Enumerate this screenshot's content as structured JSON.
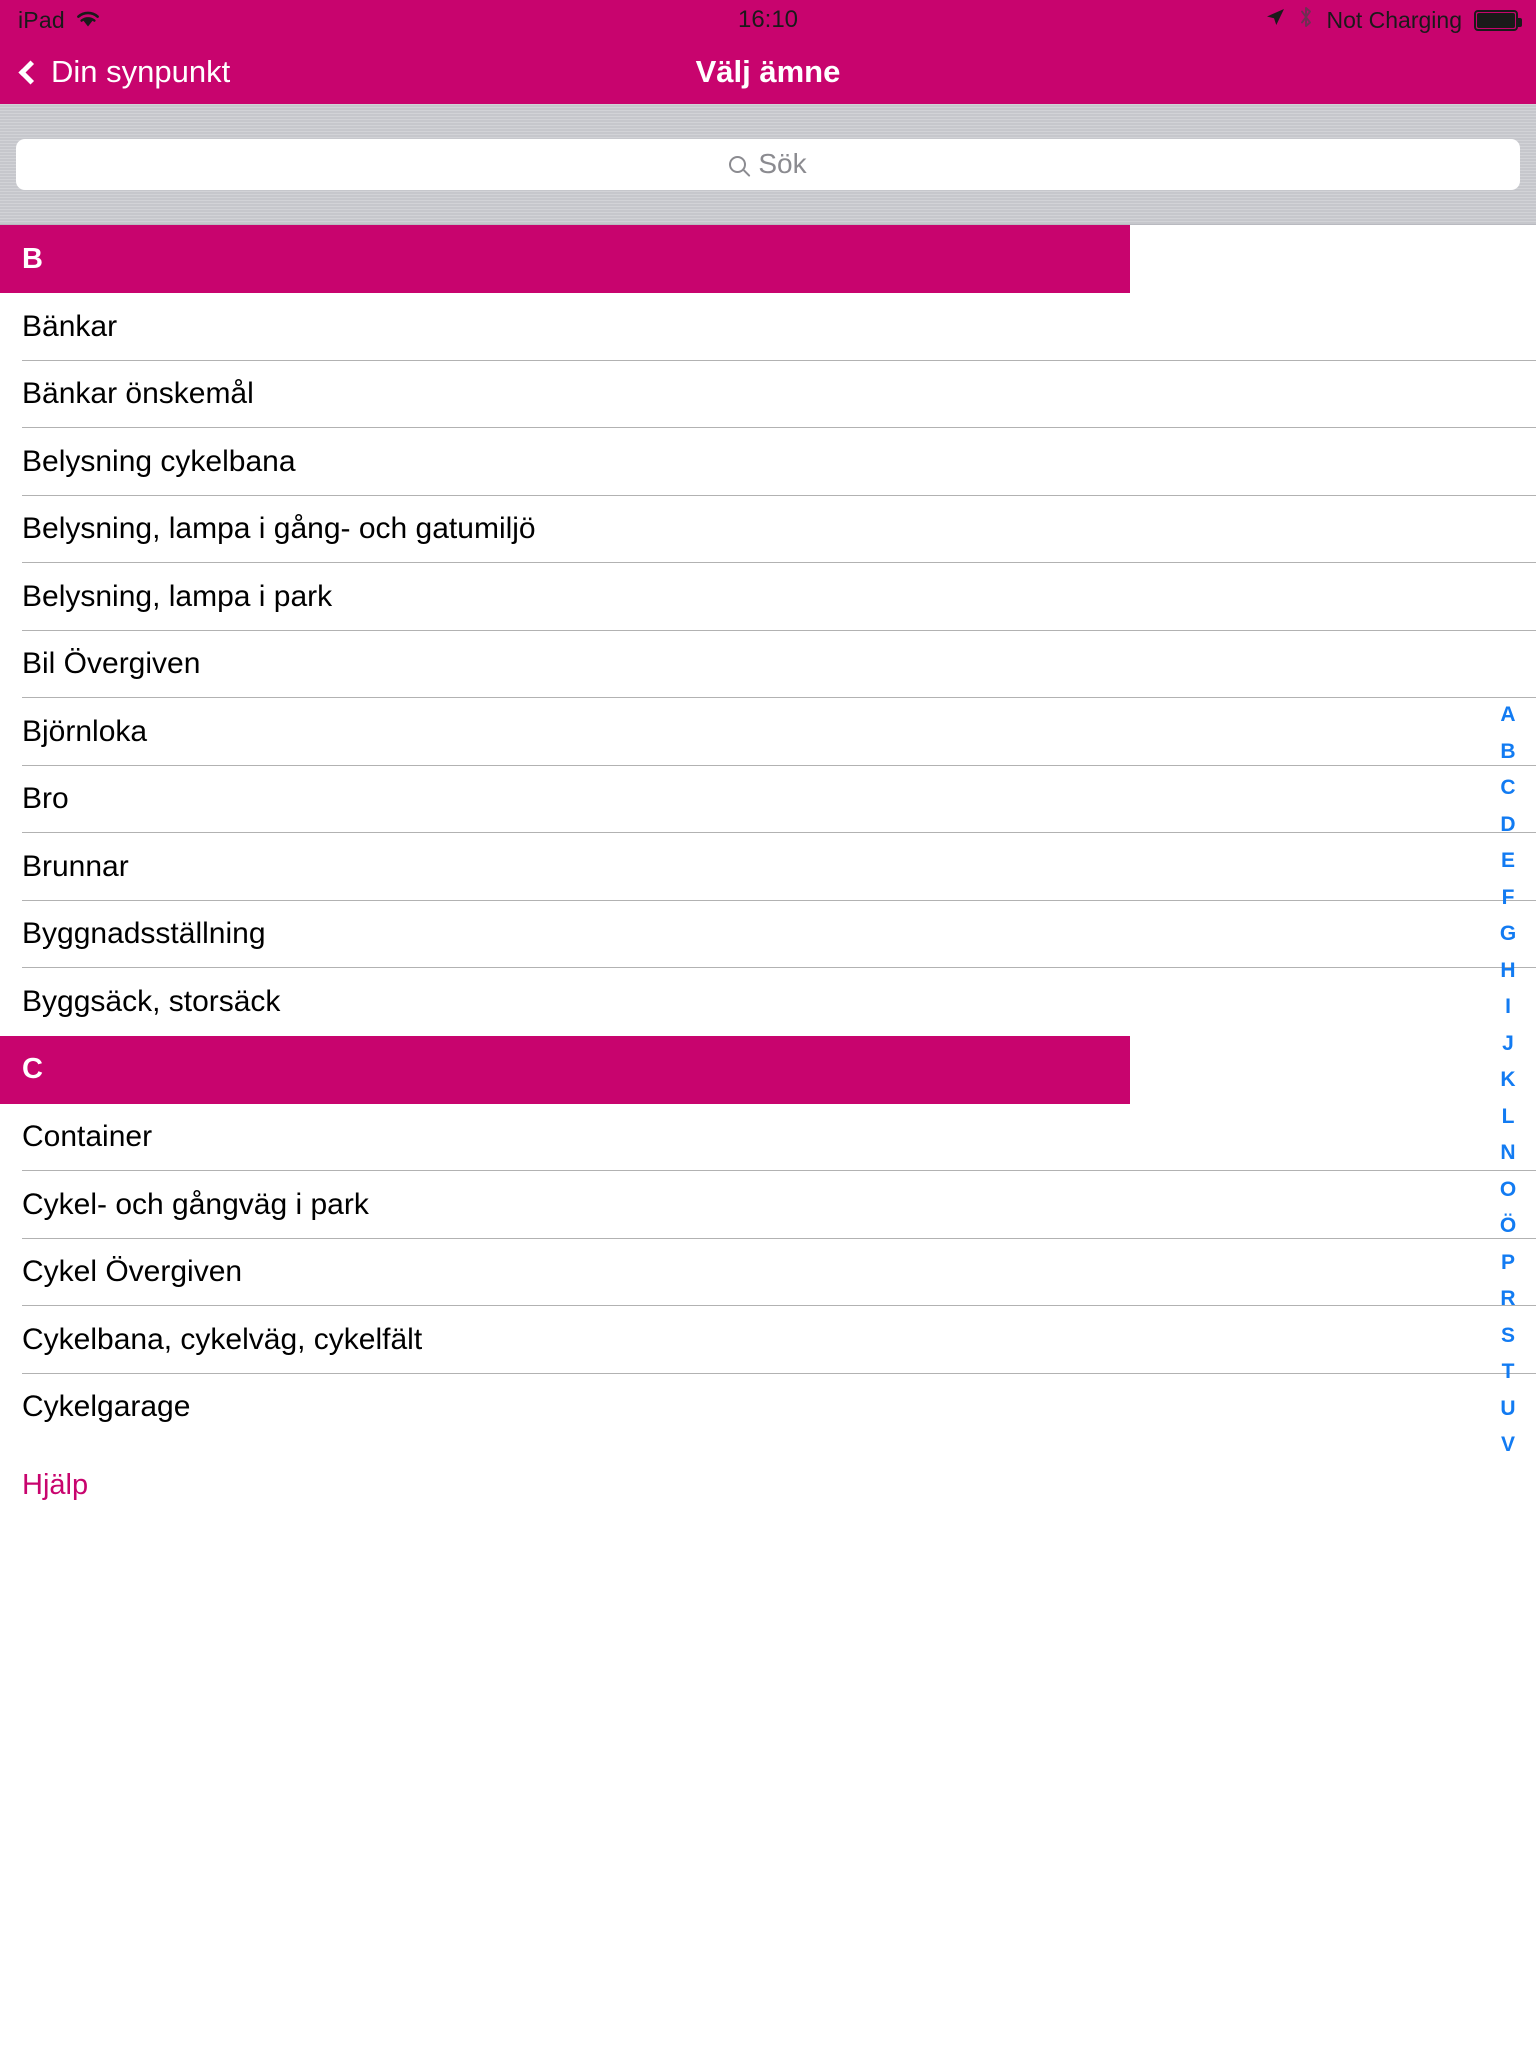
{
  "status_bar": {
    "carrier": "iPad",
    "wifi_icon": "wifi-icon",
    "time": "16:10",
    "location_icon": "location-arrow-icon",
    "bluetooth_icon": "bluetooth-icon",
    "charging_label": "Not Charging",
    "battery_icon": "battery-full-icon"
  },
  "nav_bar": {
    "back_label": "Din synpunkt",
    "back_icon": "chevron-left-icon",
    "title": "Välj ämne",
    "background_color": "#C8046E"
  },
  "search": {
    "placeholder": "Sök",
    "value": "",
    "icon": "search-icon"
  },
  "sections": [
    {
      "header": "B",
      "items": [
        "Bänkar",
        "Bänkar önskemål",
        "Belysning cykelbana",
        "Belysning, lampa i gång- och gatumiljö",
        "Belysning, lampa i park",
        "Bil Övergiven",
        "Björnloka",
        "Bro",
        "Brunnar",
        "Byggnadsställning",
        "Byggsäck, storsäck"
      ]
    },
    {
      "header": "C",
      "items": [
        "Container",
        "Cykel- och gångväg i park",
        "Cykel Övergiven",
        "Cykelbana, cykelväg, cykelfält",
        "Cykelgarage"
      ]
    }
  ],
  "index_bar": {
    "letters": [
      "A",
      "B",
      "C",
      "D",
      "E",
      "F",
      "G",
      "H",
      "I",
      "J",
      "K",
      "L",
      "N",
      "O",
      "Ö",
      "P",
      "R",
      "S",
      "T",
      "U",
      "V"
    ],
    "color": "#127BF2"
  },
  "footer": {
    "help_label": "Hjälp",
    "help_color": "#C8046E"
  }
}
